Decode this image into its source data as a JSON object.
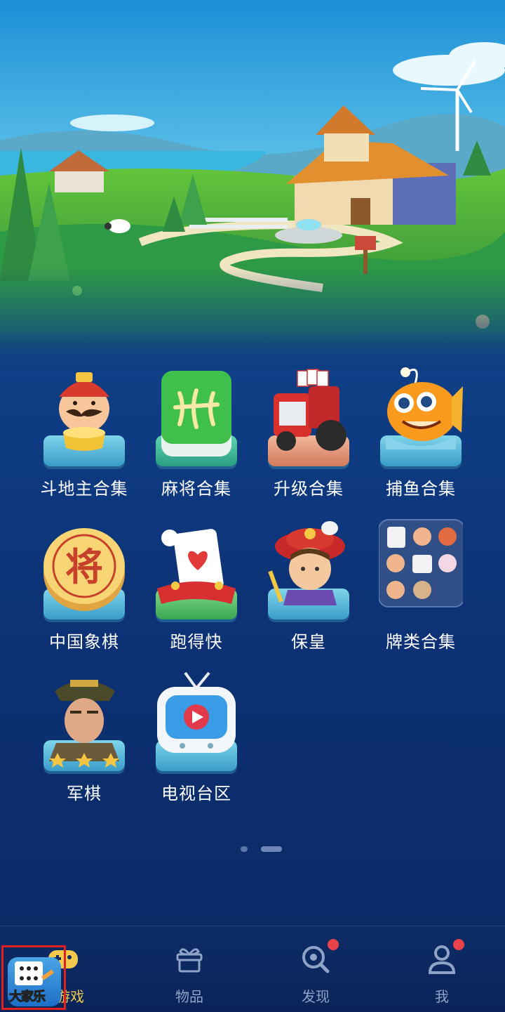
{
  "games": [
    {
      "label": "斗地主合集",
      "icon": "landlord-icon"
    },
    {
      "label": "麻将合集",
      "icon": "mahjong-icon"
    },
    {
      "label": "升级合集",
      "icon": "tractor-icon"
    },
    {
      "label": "捕鱼合集",
      "icon": "fish-icon"
    },
    {
      "label": "中国象棋",
      "icon": "xiangqi-icon"
    },
    {
      "label": "跑得快",
      "icon": "paodekuai-icon"
    },
    {
      "label": "保皇",
      "icon": "baohuang-icon"
    },
    {
      "label": "牌类合集",
      "icon": "card-collection-icon"
    },
    {
      "label": "军棋",
      "icon": "junqi-icon"
    },
    {
      "label": "电视台区",
      "icon": "tv-icon"
    }
  ],
  "xiangqi_char": "将",
  "pagination": {
    "pages": 2,
    "current": 2
  },
  "nav": [
    {
      "label": "游戏",
      "icon": "gamepad-icon",
      "active": true
    },
    {
      "label": "物品",
      "icon": "gift-icon",
      "active": false
    },
    {
      "label": "发现",
      "icon": "discover-icon",
      "active": false,
      "badge": true
    },
    {
      "label": "我",
      "icon": "user-icon",
      "active": false,
      "badge": true
    }
  ],
  "app_icon": {
    "brand": "大家乐"
  },
  "colors": {
    "accent": "#f2c94c",
    "badge": "#e8434a",
    "background": "#0b2a66"
  }
}
